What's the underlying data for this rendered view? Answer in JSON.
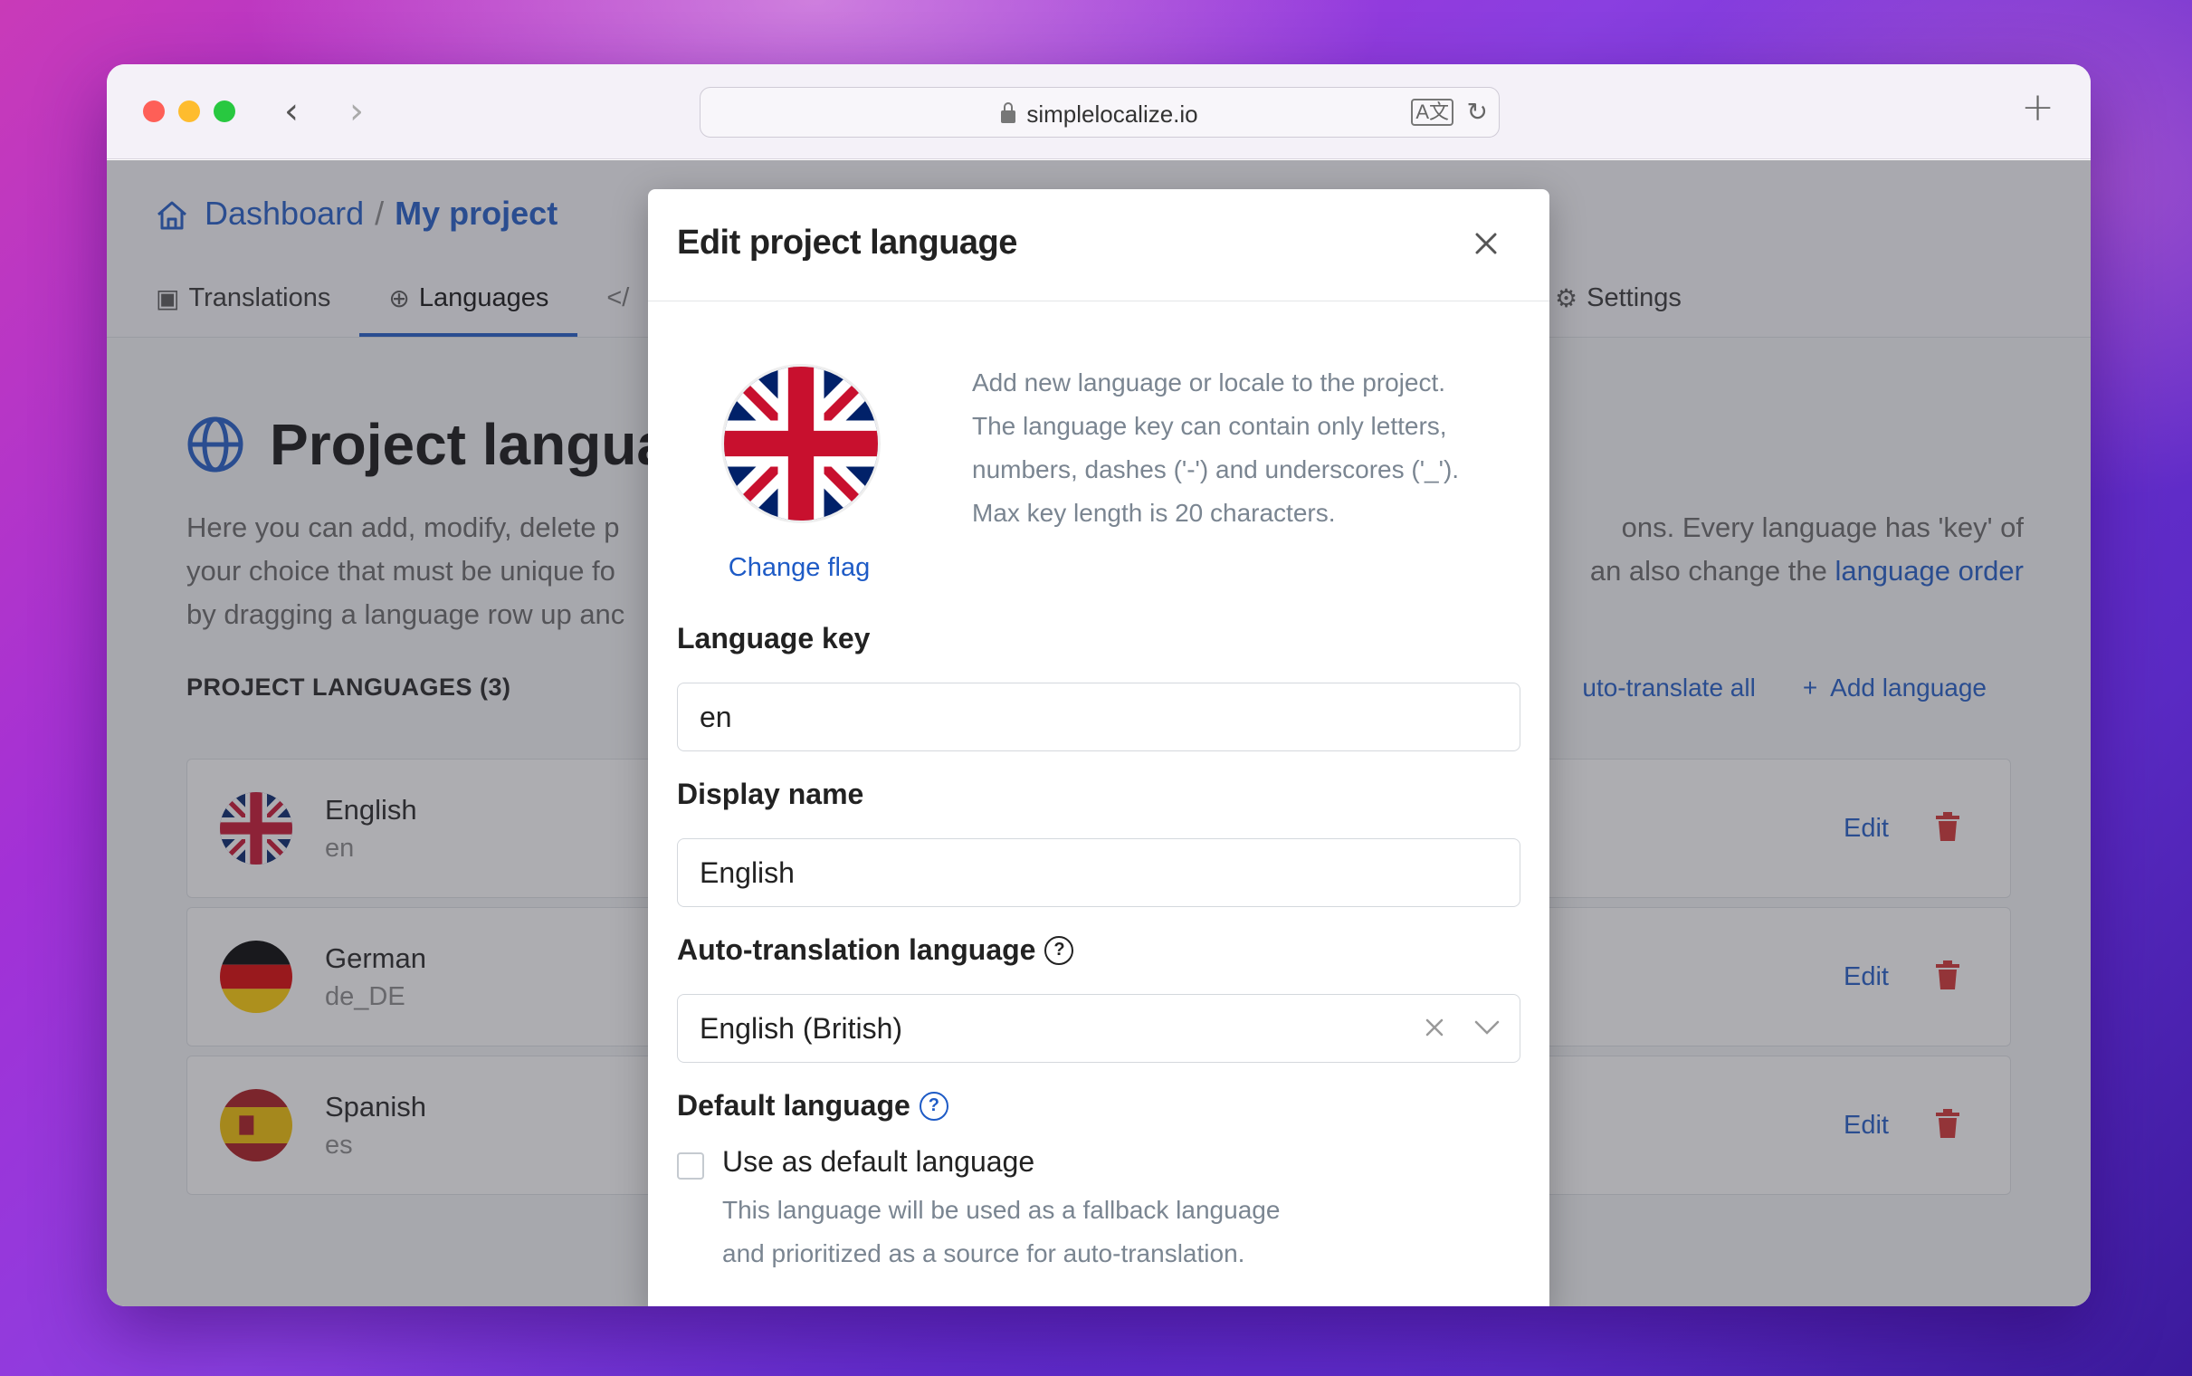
{
  "browser": {
    "url": "simplelocalize.io"
  },
  "breadcrumb": {
    "root": "Dashboard",
    "separator": "/",
    "current": "My project"
  },
  "tabs": [
    {
      "label": "Translations",
      "icon": "translations-icon"
    },
    {
      "label": "Languages",
      "icon": "globe-icon",
      "active": true
    },
    {
      "label": "</",
      "icon": "code-icon"
    },
    {
      "label": "Settings",
      "icon": "gear-icon"
    }
  ],
  "page": {
    "title": "Project langua",
    "description_line1": "Here you can add, modify, delete p",
    "description_line1_right": "ons. Every language has 'key' of",
    "description_line2": "your choice that must be unique fo",
    "description_line2_right": "an also change the ",
    "description_link": "language order",
    "description_line3": "by dragging a language row up anc",
    "section_label": "PROJECT LANGUAGES (3)",
    "auto_translate_all": "uto-translate all",
    "add_language": "Add language"
  },
  "languages": [
    {
      "name": "English",
      "key": "en",
      "edit": "Edit"
    },
    {
      "name": "German",
      "key": "de_DE",
      "edit": "Edit"
    },
    {
      "name": "Spanish",
      "key": "es",
      "edit": "Edit"
    }
  ],
  "modal": {
    "title": "Edit project language",
    "change_flag": "Change flag",
    "help_line1": "Add new language or locale to the project.",
    "help_line2": "The language key can contain only letters,",
    "help_line3": "numbers, dashes ('-') and underscores ('_').",
    "help_line4": "Max key length is 20 characters.",
    "language_key_label": "Language key",
    "language_key_value": "en",
    "display_name_label": "Display name",
    "display_name_value": "English",
    "auto_translation_label": "Auto-translation language",
    "auto_translation_value": "English (British)",
    "default_language_label": "Default language",
    "use_default_label": "Use as default language",
    "use_default_help_line1": "This language will be used as a fallback language",
    "use_default_help_line2": "and prioritized as a source for auto-translation.",
    "use_default_checked": false
  },
  "colors": {
    "accent": "#1e5bc6",
    "danger": "#d32f2f"
  }
}
